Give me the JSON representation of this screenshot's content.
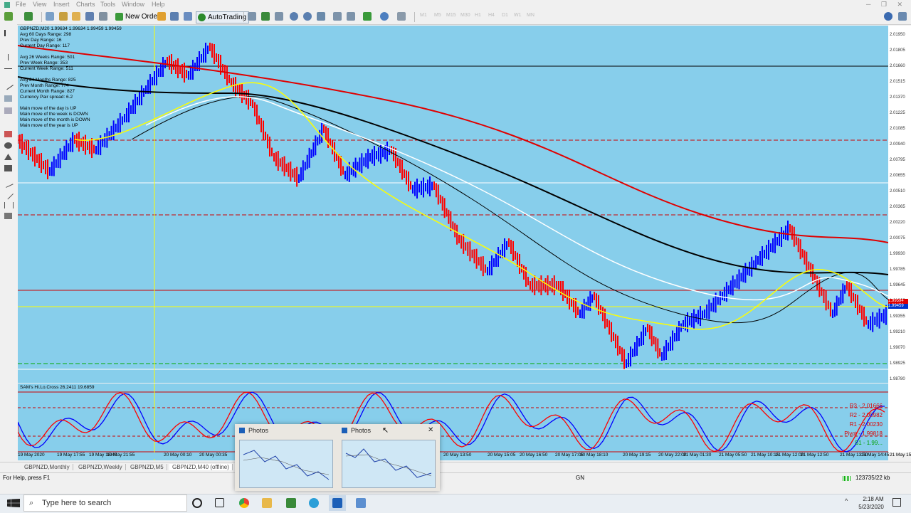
{
  "menu": [
    "File",
    "View",
    "Insert",
    "Charts",
    "Tools",
    "Window",
    "Help"
  ],
  "toolbar": {
    "new_order": "New Order",
    "autotrading": "AutoTrading",
    "timeframes": [
      "M1",
      "M5",
      "M15",
      "M30",
      "H1",
      "H4",
      "D1",
      "W1",
      "MN"
    ]
  },
  "chart": {
    "header": "GBPNZD,M20  1.99634 1.99634 1.99459 1.99459",
    "info_lines": [
      "Avg 60 Days Range: 298",
      "Prev Day Range: 16",
      "Current Day Range: 117",
      "",
      "Avg 26 Weeks Range: 501",
      "Prev Week Range: 353",
      "Current Week Range: 511",
      "",
      "Avg 24 Months Range: 825",
      "Prev Month Range: 774",
      "Current Month Range: 827",
      "Currency Pair spread: 6.2",
      "",
      "Main move of the day is UP",
      "Main move of the week is DOWN",
      "Main move of the month is DOWN",
      "Main move of the year is UP"
    ],
    "price_labels": [
      "2.01950",
      "2.01805",
      "2.01660",
      "2.01515",
      "2.01370",
      "2.01225",
      "2.01085",
      "2.00940",
      "2.00795",
      "2.00655",
      "2.00510",
      "2.00365",
      "2.00220",
      "2.00075",
      "1.99930",
      "1.99785",
      "1.99645",
      "1.99500",
      "1.99355",
      "1.99210",
      "1.99070",
      "1.98925",
      "1.98780"
    ],
    "price_tags": [
      "1.99594",
      "1.99459"
    ],
    "colors": {
      "background": "#87ceeb",
      "up_bar": "#0000ff",
      "down_bar": "#ff0000",
      "ma_red": "#e00000",
      "ma_black": "#000000",
      "ma_white": "#ffffff",
      "ma_yellow": "#ffff00"
    }
  },
  "indicator": {
    "label": "SAM's Hi.Lo.Cross 26.2411 19.6859",
    "pivots": [
      "R3 - 2.01666",
      "R2 - 2.00982",
      "R1 - 2.00230",
      "Pivot - 1.99818",
      "S1 - 1.99..."
    ]
  },
  "time_labels": [
    "19 May 2020",
    "19 May 17:55",
    "19 May 18:40",
    "19 May 21:55",
    "20 May 00:10",
    "20 May 00:35",
    "20 May 13:50",
    "20 May 15:05",
    "20 May 16:50",
    "20 May 17:05",
    "20 May 18:10",
    "20 May 19:15",
    "20 May 22:00",
    "21 May 01:30",
    "21 May 05:50",
    "21 May 10:15",
    "21 May 12:00",
    "21 May 12:50",
    "21 May 13:50",
    "21 May 14:45",
    "21 May 15:55"
  ],
  "tabs": [
    "GBPNZD,Monthly",
    "GBPNZD,Weekly",
    "GBPNZD,M5",
    "GBPNZD,M40 (offline)"
  ],
  "status": {
    "help": "For Help, press F1",
    "mid": "GN",
    "traffic": "123735/22 kb"
  },
  "popup": {
    "title1": "Photos",
    "title2": "Photos",
    "close": "✕"
  },
  "taskbar": {
    "search_placeholder": "Type here to search",
    "time": "2:18 AM",
    "date": "5/23/2020"
  }
}
